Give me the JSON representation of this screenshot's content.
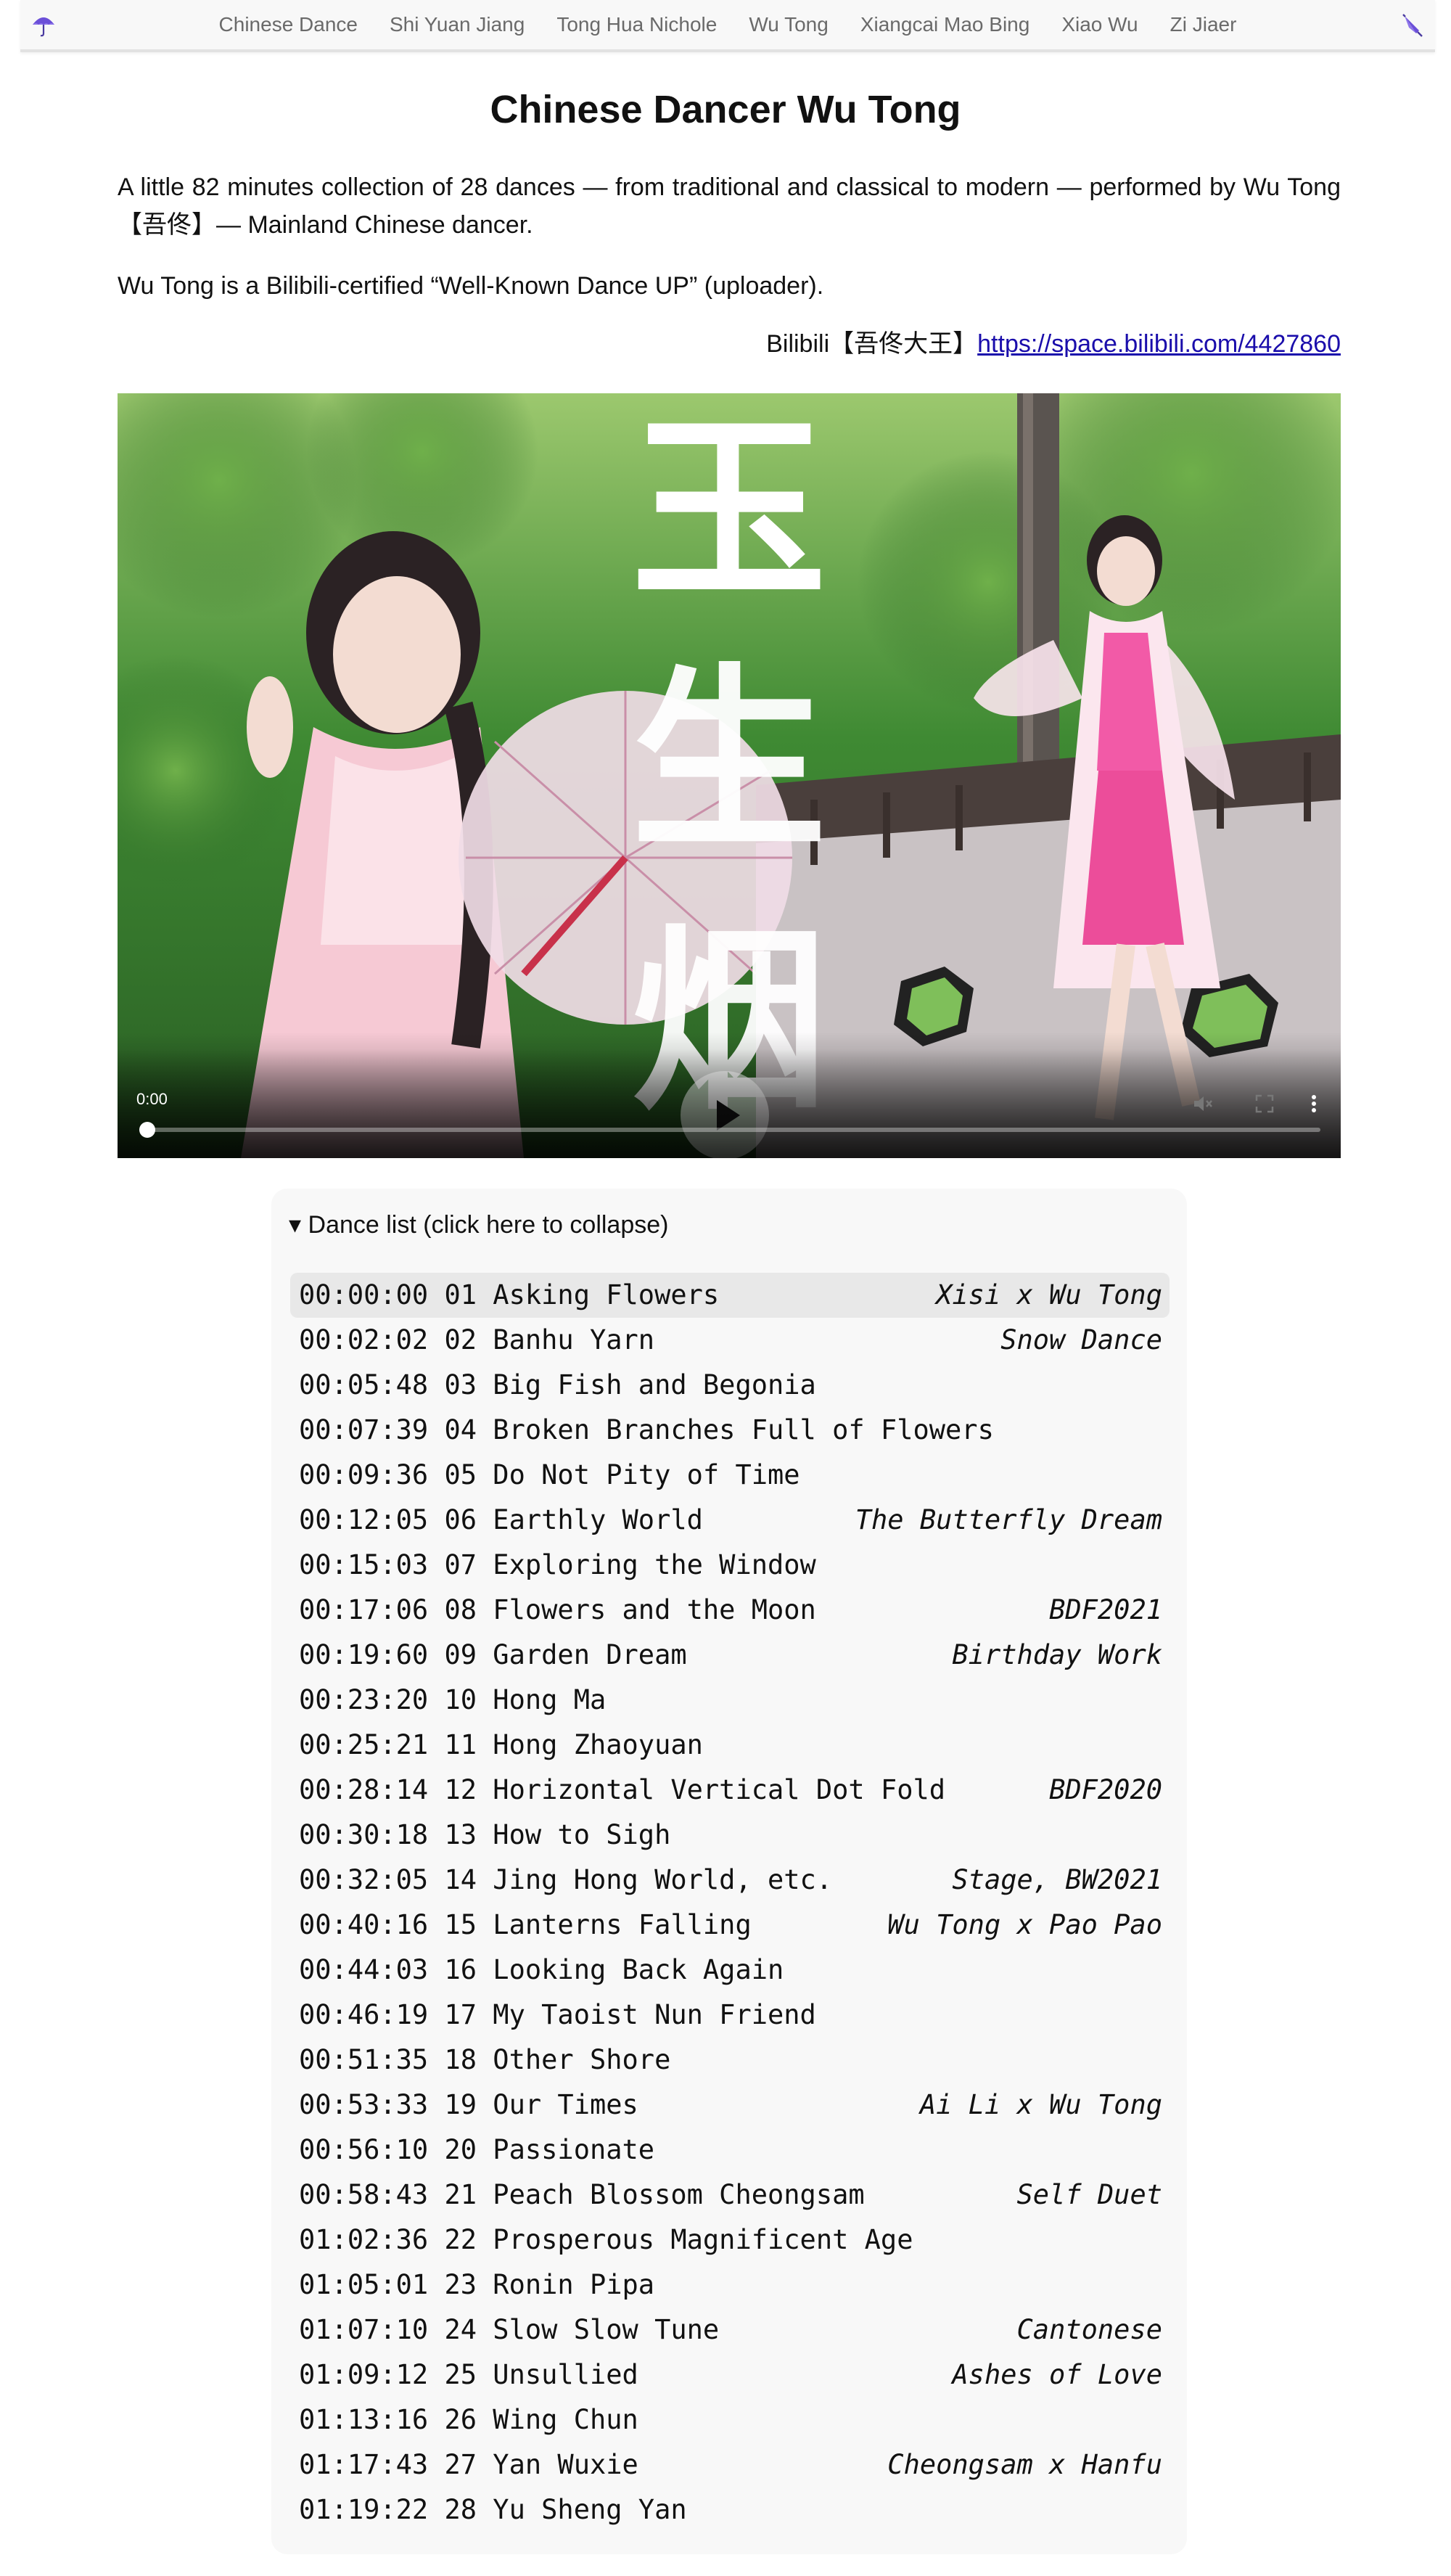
{
  "nav": {
    "links": [
      "Chinese Dance",
      "Shi Yuan Jiang",
      "Tong Hua Nichole",
      "Wu Tong",
      "Xiangcai Mao Bing",
      "Xiao Wu",
      "Zi Jiaer"
    ],
    "left_icon": "umbrella-icon",
    "right_icon": "closed-umbrella-icon",
    "accent": "#6b4fd8"
  },
  "page": {
    "title": "Chinese Dancer Wu Tong",
    "intro": "A little 82 minutes collection of 28 dances — from traditional and classical to modern — performed by Wu Tong【吾佟】— Mainland Chinese dancer.",
    "intro2": "Wu Tong is a Bilibili-certified “Well-Known Dance UP” (uploader).",
    "bili_prefix": "Bilibili【吾佟大王】",
    "bili_link": "https://space.bilibili.com/4427860"
  },
  "video": {
    "time": "0:00",
    "poster_text": "玉生烟",
    "progress": 0.0
  },
  "dance_list": {
    "summary": "▾ Dance list (click here to collapse)",
    "items": [
      {
        "text": "00:00:00 01 Asking Flowers",
        "note": "Xisi x Wu Tong",
        "active": true
      },
      {
        "text": "00:02:02 02 Banhu Yarn",
        "note": "Snow Dance"
      },
      {
        "text": "00:05:48 03 Big Fish and Begonia",
        "note": ""
      },
      {
        "text": "00:07:39 04 Broken Branches Full of Flowers",
        "note": ""
      },
      {
        "text": "00:09:36 05 Do Not Pity of Time",
        "note": ""
      },
      {
        "text": "00:12:05 06 Earthly World",
        "note": "The Butterfly Dream"
      },
      {
        "text": "00:15:03 07 Exploring the Window",
        "note": ""
      },
      {
        "text": "00:17:06 08 Flowers and the Moon",
        "note": "BDF2021"
      },
      {
        "text": "00:19:60 09 Garden Dream",
        "note": "Birthday Work"
      },
      {
        "text": "00:23:20 10 Hong Ma",
        "note": ""
      },
      {
        "text": "00:25:21 11 Hong Zhaoyuan",
        "note": ""
      },
      {
        "text": "00:28:14 12 Horizontal Vertical Dot Fold",
        "note": "BDF2020"
      },
      {
        "text": "00:30:18 13 How to Sigh",
        "note": ""
      },
      {
        "text": "00:32:05 14 Jing Hong World, etc.",
        "note": "Stage, BW2021"
      },
      {
        "text": "00:40:16 15 Lanterns Falling",
        "note": "Wu Tong x Pao Pao"
      },
      {
        "text": "00:44:03 16 Looking Back Again",
        "note": ""
      },
      {
        "text": "00:46:19 17 My Taoist Nun Friend",
        "note": ""
      },
      {
        "text": "00:51:35 18 Other Shore",
        "note": ""
      },
      {
        "text": "00:53:33 19 Our Times",
        "note": "Ai Li x Wu Tong"
      },
      {
        "text": "00:56:10 20 Passionate",
        "note": ""
      },
      {
        "text": "00:58:43 21 Peach Blossom Cheongsam",
        "note": "Self Duet"
      },
      {
        "text": "01:02:36 22 Prosperous Magnificent Age",
        "note": ""
      },
      {
        "text": "01:05:01 23 Ronin Pipa",
        "note": ""
      },
      {
        "text": "01:07:10 24 Slow Slow Tune",
        "note": "Cantonese"
      },
      {
        "text": "01:09:12 25 Unsullied",
        "note": "Ashes of Love"
      },
      {
        "text": "01:13:16 26 Wing Chun",
        "note": ""
      },
      {
        "text": "01:17:43 27 Yan Wuxie",
        "note": "Cheongsam x Hanfu"
      },
      {
        "text": "01:19:22 28 Yu Sheng Yan",
        "note": ""
      }
    ]
  }
}
